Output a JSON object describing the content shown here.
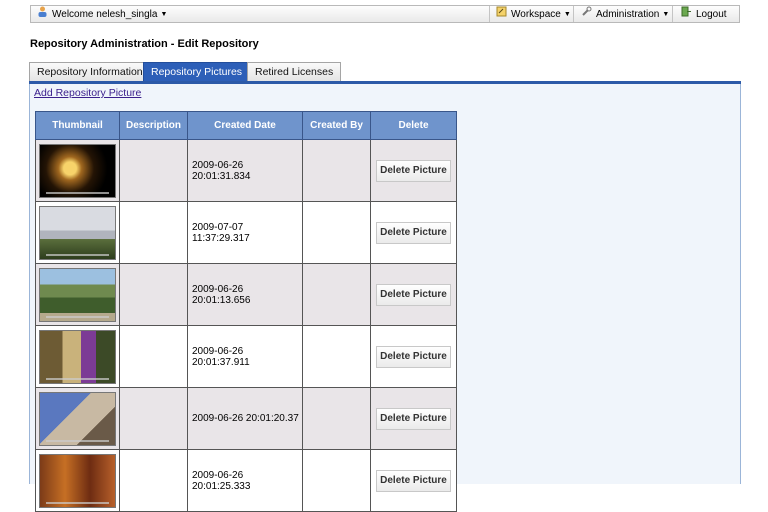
{
  "toolbar": {
    "welcome": "Welcome nelesh_singla",
    "workspace": "Workspace",
    "administration": "Administration",
    "logout": "Logout"
  },
  "page_title": "Repository Administration - Edit Repository",
  "tabs": [
    {
      "label": "Repository Information",
      "active": false
    },
    {
      "label": "Repository Pictures",
      "active": true
    },
    {
      "label": "Retired Licenses",
      "active": false
    }
  ],
  "add_link": "Add Repository Picture",
  "table": {
    "headers": [
      "Thumbnail",
      "Description",
      "Created Date",
      "Created By",
      "Delete"
    ],
    "rows": [
      {
        "thumbnail": "night-palace-photo",
        "description": "",
        "created_date": "2009-06-26 20:01:31.834",
        "created_by": "",
        "delete_label": "Delete Picture"
      },
      {
        "thumbnail": "castle-photo",
        "description": "",
        "created_date": "2009-07-07 11:37:29.317",
        "created_by": "",
        "delete_label": "Delete Picture"
      },
      {
        "thumbnail": "garden-building-photo",
        "description": "",
        "created_date": "2009-06-26 20:01:13.656",
        "created_by": "",
        "delete_label": "Delete Picture"
      },
      {
        "thumbnail": "reader-photo",
        "description": "",
        "created_date": "2009-06-26 20:01:37.911",
        "created_by": "",
        "delete_label": "Delete Picture"
      },
      {
        "thumbnail": "facade-photo",
        "description": "",
        "created_date": "2009-06-26 20:01:20.37",
        "created_by": "",
        "delete_label": "Delete Picture"
      },
      {
        "thumbnail": "carved-door-photo",
        "description": "",
        "created_date": "2009-06-26 20:01:25.333",
        "created_by": "",
        "delete_label": "Delete Picture"
      }
    ]
  },
  "colors": {
    "tab_active": "#2d5fb8",
    "header_bg": "#6f94cc",
    "row_alt": "#e9e5e8",
    "link": "#3a1e8c"
  }
}
